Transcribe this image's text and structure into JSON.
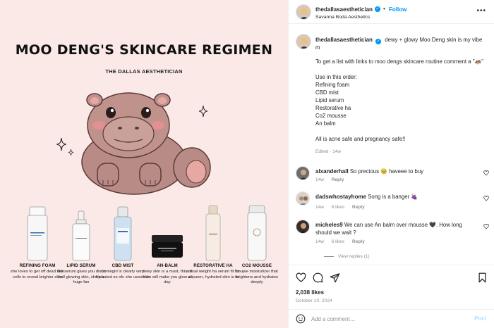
{
  "post_image": {
    "title": "MOO DENG'S SKINCARE REGIMEN",
    "subtitle": "THE DALLAS AESTHETICIAN",
    "products": [
      {
        "name": "REFINING FOAM",
        "desc": "she loves to get off dead skin cells to reveal brighter skin"
      },
      {
        "name": "LIPID SERUM",
        "desc": "this serum gives you disco ball glowing skin, she's a huge fan"
      },
      {
        "name": "CBD MIST",
        "desc": "homegirl is clearly very hydrated so ofc she uses this"
      },
      {
        "name": "AN-BALM",
        "desc": "dewy skin is a must, this oil balm will make you glow all day"
      },
      {
        "name": "RESTORATIVE HA",
        "desc": "a dual weight ha serum fit for a queen, hydrated skin is in"
      },
      {
        "name": "CO2 MOUSSE",
        "desc": "boujee moisturizer that brightens and hydrates deeply"
      }
    ],
    "colors": {
      "background": "#fbe9e8",
      "hippo": "#b98b86"
    }
  },
  "header": {
    "username": "thedallasaesthetician",
    "follow_label": "Follow",
    "subline": "Savanna Boda Aesthetics",
    "more_label": "•••"
  },
  "caption": {
    "username": "thedallasaesthetician",
    "headline": "dewy + glowy Moo Deng skin is my vibe m",
    "lines": [
      "To get a list with links to moo dengs skincare routine comment a \"🦛\"",
      "",
      "Use in this order:",
      "Refining foam",
      "CBD mist",
      "Lipid serum",
      "Restorative ha",
      "Co2 mousse",
      "An balm",
      "",
      "All is acne safe and pregnancy safe!!"
    ],
    "edited": "Edited · 14w"
  },
  "comments": [
    {
      "username": "alxanderhall",
      "text": "So precious 🥹 haveee to buy",
      "age": "14w",
      "likes": "",
      "reply_label": "Reply"
    },
    {
      "username": "dadswhostayhome",
      "text": "Song is a banger 🍇",
      "age": "14w",
      "likes": "6 likes",
      "reply_label": "Reply"
    },
    {
      "username": "micheles9",
      "text": "We can use An balm over mousse 🖤. How long should we wait ?",
      "age": "14w",
      "likes": "6 likes",
      "reply_label": "Reply"
    }
  ],
  "view_replies": "View replies (1)",
  "actions": {
    "likes": "2,038 likes",
    "date": "October 10, 2024"
  },
  "add_comment": {
    "placeholder": "Add a comment…",
    "post_label": "Post"
  },
  "colors": {
    "accent": "#0095f6",
    "muted": "#8e8e8e",
    "text": "#262626"
  }
}
